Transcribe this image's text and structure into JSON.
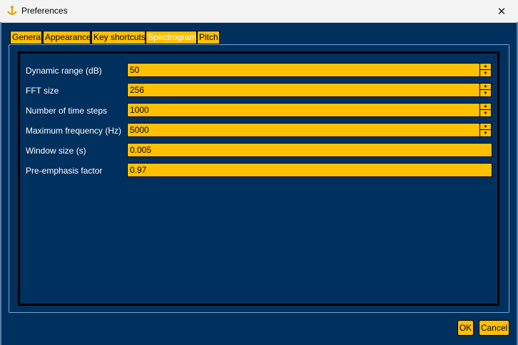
{
  "window": {
    "title": "Preferences",
    "close_glyph": "✕"
  },
  "tabs": [
    {
      "label": "General"
    },
    {
      "label": "Appearance"
    },
    {
      "label": "Key shortcuts"
    },
    {
      "label": "Spectrogram",
      "active": true
    },
    {
      "label": "Pitch"
    }
  ],
  "fields": {
    "dynamic_range": {
      "label": "Dynamic range (dB)",
      "value": "50"
    },
    "fft_size": {
      "label": "FFT size",
      "value": "256"
    },
    "time_steps": {
      "label": "Number of time steps",
      "value": "1000"
    },
    "max_frequency": {
      "label": "Maximum frequency (Hz)",
      "value": "5000"
    },
    "window_size": {
      "label": "Window size (s)",
      "value": "0.005"
    },
    "pre_emphasis": {
      "label": "Pre-emphasis factor",
      "value": "0.97"
    }
  },
  "buttons": {
    "ok": "OK",
    "cancel": "Cancel"
  },
  "colors": {
    "background": "#00305e",
    "accent": "#ffc000",
    "border": "#000000"
  },
  "icons": {
    "app": "anchor-icon",
    "close": "close-icon",
    "spin_up": "spin-up-arrow-icon",
    "spin_down": "spin-down-arrow-icon"
  }
}
